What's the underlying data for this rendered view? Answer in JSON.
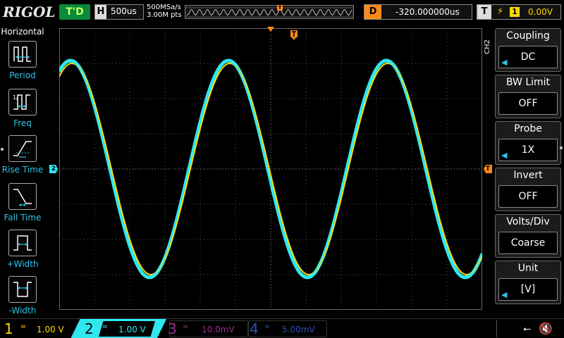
{
  "brand": "RIGOL",
  "top": {
    "run_state": "T'D",
    "timebase_tag": "H",
    "timebase": "500us",
    "sample_rate": "500MSa/s",
    "mem_depth": "3.00M pts",
    "delay_tag": "D",
    "delay": "-320.000000us",
    "trigger_tag": "T",
    "trigger_source": "1",
    "trigger_level": "0.00V"
  },
  "left_panel": {
    "title": "Horizontal",
    "items": [
      {
        "label": "Period",
        "icon": "period-icon"
      },
      {
        "label": "Freq",
        "icon": "frequency-icon"
      },
      {
        "label": "Rise Time",
        "icon": "rise-time-icon"
      },
      {
        "label": "Fall Time",
        "icon": "fall-time-icon"
      },
      {
        "label": "+Width",
        "icon": "positive-width-icon"
      },
      {
        "label": "-Width",
        "icon": "negative-width-icon"
      }
    ]
  },
  "right_panel": {
    "channel": "CH2",
    "items": [
      {
        "title": "Coupling",
        "value": "DC"
      },
      {
        "title": "BW Limit",
        "value": "OFF"
      },
      {
        "title": "Probe",
        "value": "1X"
      },
      {
        "title": "Invert",
        "value": "OFF"
      },
      {
        "title": "Volts/Div",
        "value": "Coarse"
      },
      {
        "title": "Unit",
        "value": "[V]"
      }
    ]
  },
  "markers": {
    "ch2": "2",
    "trigger_position": "T"
  },
  "channels": [
    {
      "num": "1",
      "scale": "1.00 V",
      "color": "#ffd800"
    },
    {
      "num": "2",
      "scale": "1.00 V",
      "color": "#2ee8f0"
    },
    {
      "num": "3",
      "scale": "10.0mV",
      "color": "#9a2f8a"
    },
    {
      "num": "4",
      "scale": "5.00mV",
      "color": "#2c4fb8"
    }
  ],
  "colors": {
    "ch1": "#ffd800",
    "ch2": "#2ee8f0",
    "trigger": "#ff8a1a",
    "accent": "#2ec4e8"
  }
}
